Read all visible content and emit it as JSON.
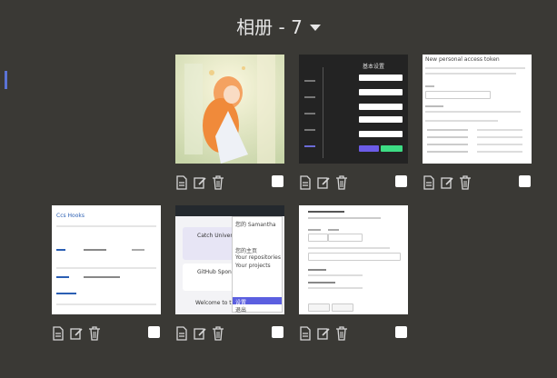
{
  "header": {
    "title": "相册 - 7"
  },
  "icons": {
    "doc": "document-icon",
    "edit": "edit-icon",
    "delete": "trash-icon",
    "dropdown": "caret-down-icon"
  },
  "colors": {
    "background": "#3a3935",
    "accent": "#5b73d6"
  },
  "photos": [
    {
      "name": "photo-1",
      "kind": "anime illustration"
    },
    {
      "name": "photo-2",
      "kind": "settings dialog",
      "texts": [
        "基本设置"
      ]
    },
    {
      "name": "photo-3",
      "kind": "settings page",
      "texts": [
        "New personal access token"
      ]
    },
    {
      "name": "photo-4",
      "kind": "document",
      "texts": [
        "Ccs Hooks"
      ]
    },
    {
      "name": "photo-5",
      "kind": "github menu",
      "texts": [
        "Catch Universe",
        "GitHub Sponsors",
        "Welcome to the"
      ],
      "menu": [
        "您的 Samantha",
        "您的主页",
        "Your repositories",
        "Your projects",
        "设置",
        "退出"
      ]
    },
    {
      "name": "photo-6",
      "kind": "form page"
    }
  ]
}
